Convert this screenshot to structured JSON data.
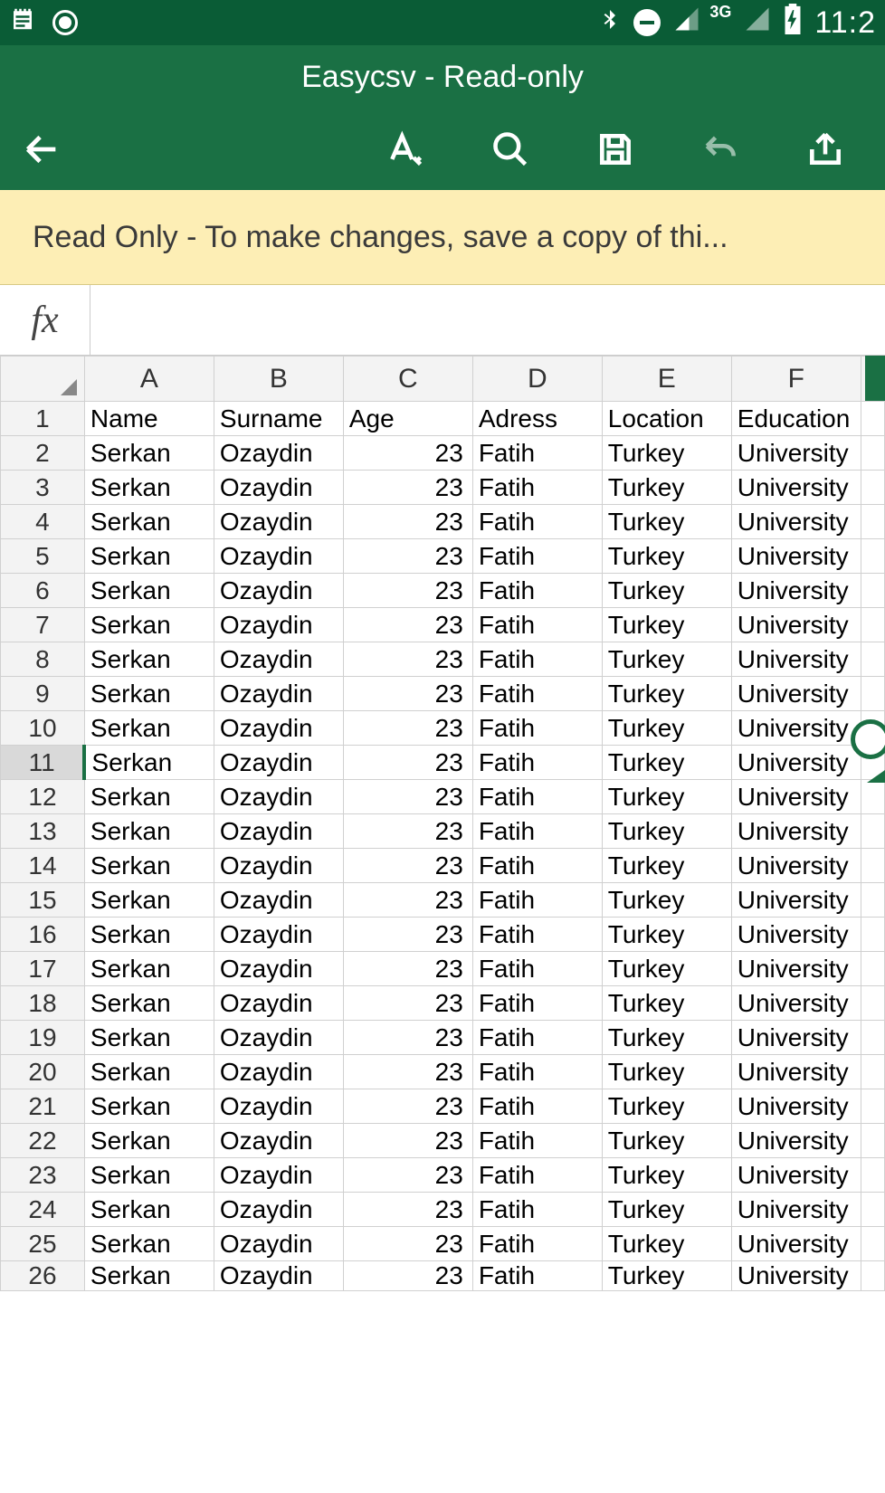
{
  "status": {
    "network_label": "3G",
    "clock": "11:2"
  },
  "titlebar": {
    "title": "Easycsv - Read-only"
  },
  "toolbar": {
    "back_name": "back",
    "edit_name": "edit",
    "search_name": "search",
    "save_name": "save",
    "undo_name": "undo",
    "share_name": "share"
  },
  "banner": {
    "text": "Read Only - To make changes, save a copy of thi..."
  },
  "formula": {
    "fx_label": "fx",
    "value": ""
  },
  "sheet": {
    "columns": [
      "A",
      "B",
      "C",
      "D",
      "E",
      "F"
    ],
    "selected_row": 11,
    "rows": [
      {
        "n": 1,
        "A": "Name",
        "B": "Surname",
        "C": "Age",
        "D": "Adress",
        "E": "Location",
        "F": "Education"
      },
      {
        "n": 2,
        "A": "Serkan",
        "B": "Ozaydin",
        "C": "23",
        "D": "Fatih",
        "E": "Turkey",
        "F": "University"
      },
      {
        "n": 3,
        "A": "Serkan",
        "B": "Ozaydin",
        "C": "23",
        "D": "Fatih",
        "E": "Turkey",
        "F": "University"
      },
      {
        "n": 4,
        "A": "Serkan",
        "B": "Ozaydin",
        "C": "23",
        "D": "Fatih",
        "E": "Turkey",
        "F": "University"
      },
      {
        "n": 5,
        "A": "Serkan",
        "B": "Ozaydin",
        "C": "23",
        "D": "Fatih",
        "E": "Turkey",
        "F": "University"
      },
      {
        "n": 6,
        "A": "Serkan",
        "B": "Ozaydin",
        "C": "23",
        "D": "Fatih",
        "E": "Turkey",
        "F": "University"
      },
      {
        "n": 7,
        "A": "Serkan",
        "B": "Ozaydin",
        "C": "23",
        "D": "Fatih",
        "E": "Turkey",
        "F": "University"
      },
      {
        "n": 8,
        "A": "Serkan",
        "B": "Ozaydin",
        "C": "23",
        "D": "Fatih",
        "E": "Turkey",
        "F": "University"
      },
      {
        "n": 9,
        "A": "Serkan",
        "B": "Ozaydin",
        "C": "23",
        "D": "Fatih",
        "E": "Turkey",
        "F": "University"
      },
      {
        "n": 10,
        "A": "Serkan",
        "B": "Ozaydin",
        "C": "23",
        "D": "Fatih",
        "E": "Turkey",
        "F": "University"
      },
      {
        "n": 11,
        "A": "Serkan",
        "B": "Ozaydin",
        "C": "23",
        "D": "Fatih",
        "E": "Turkey",
        "F": "University"
      },
      {
        "n": 12,
        "A": "Serkan",
        "B": "Ozaydin",
        "C": "23",
        "D": "Fatih",
        "E": "Turkey",
        "F": "University"
      },
      {
        "n": 13,
        "A": "Serkan",
        "B": "Ozaydin",
        "C": "23",
        "D": "Fatih",
        "E": "Turkey",
        "F": "University"
      },
      {
        "n": 14,
        "A": "Serkan",
        "B": "Ozaydin",
        "C": "23",
        "D": "Fatih",
        "E": "Turkey",
        "F": "University"
      },
      {
        "n": 15,
        "A": "Serkan",
        "B": "Ozaydin",
        "C": "23",
        "D": "Fatih",
        "E": "Turkey",
        "F": "University"
      },
      {
        "n": 16,
        "A": "Serkan",
        "B": "Ozaydin",
        "C": "23",
        "D": "Fatih",
        "E": "Turkey",
        "F": "University"
      },
      {
        "n": 17,
        "A": "Serkan",
        "B": "Ozaydin",
        "C": "23",
        "D": "Fatih",
        "E": "Turkey",
        "F": "University"
      },
      {
        "n": 18,
        "A": "Serkan",
        "B": "Ozaydin",
        "C": "23",
        "D": "Fatih",
        "E": "Turkey",
        "F": "University"
      },
      {
        "n": 19,
        "A": "Serkan",
        "B": "Ozaydin",
        "C": "23",
        "D": "Fatih",
        "E": "Turkey",
        "F": "University"
      },
      {
        "n": 20,
        "A": "Serkan",
        "B": "Ozaydin",
        "C": "23",
        "D": "Fatih",
        "E": "Turkey",
        "F": "University"
      },
      {
        "n": 21,
        "A": "Serkan",
        "B": "Ozaydin",
        "C": "23",
        "D": "Fatih",
        "E": "Turkey",
        "F": "University"
      },
      {
        "n": 22,
        "A": "Serkan",
        "B": "Ozaydin",
        "C": "23",
        "D": "Fatih",
        "E": "Turkey",
        "F": "University"
      },
      {
        "n": 23,
        "A": "Serkan",
        "B": "Ozaydin",
        "C": "23",
        "D": "Fatih",
        "E": "Turkey",
        "F": "University"
      },
      {
        "n": 24,
        "A": "Serkan",
        "B": "Ozaydin",
        "C": "23",
        "D": "Fatih",
        "E": "Turkey",
        "F": "University"
      },
      {
        "n": 25,
        "A": "Serkan",
        "B": "Ozaydin",
        "C": "23",
        "D": "Fatih",
        "E": "Turkey",
        "F": "University"
      },
      {
        "n": 26,
        "A": "Serkan",
        "B": "Ozaydin",
        "C": "23",
        "D": "Fatih",
        "E": "Turkey",
        "F": "University"
      }
    ]
  }
}
